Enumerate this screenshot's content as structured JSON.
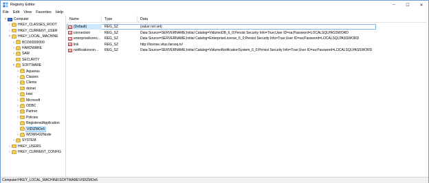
{
  "window": {
    "title": "Registry Editor",
    "controls": [
      "–",
      "☐",
      "✕"
    ]
  },
  "menu": [
    "File",
    "Edit",
    "View",
    "Favorites",
    "Help"
  ],
  "tree": [
    {
      "label": "Computer",
      "level": 0,
      "expander": "open",
      "icon": "computer-icon"
    },
    {
      "label": "HKEY_CLASSES_ROOT",
      "level": 1,
      "expander": "closed",
      "icon": "folder-icon"
    },
    {
      "label": "HKEY_CURRENT_USER",
      "level": 1,
      "expander": "closed",
      "icon": "folder-icon"
    },
    {
      "label": "HKEY_LOCAL_MACHINE",
      "level": 1,
      "expander": "open",
      "icon": "folder-icon"
    },
    {
      "label": "BCD00000000",
      "level": 2,
      "expander": "closed",
      "icon": "folder-icon"
    },
    {
      "label": "HARDWARE",
      "level": 2,
      "expander": "closed",
      "icon": "folder-icon"
    },
    {
      "label": "SAM",
      "level": 2,
      "expander": "closed",
      "icon": "folder-icon"
    },
    {
      "label": "SECURITY",
      "level": 2,
      "expander": "none",
      "icon": "folder-icon"
    },
    {
      "label": "SOFTWARE",
      "level": 2,
      "expander": "open",
      "icon": "folder-icon"
    },
    {
      "label": "Aquarius",
      "level": 3,
      "expander": "closed",
      "icon": "folder-icon"
    },
    {
      "label": "Classes",
      "level": 3,
      "expander": "closed",
      "icon": "folder-icon"
    },
    {
      "label": "Clients",
      "level": 3,
      "expander": "closed",
      "icon": "folder-icon"
    },
    {
      "label": "dotnet",
      "level": 3,
      "expander": "closed",
      "icon": "folder-icon"
    },
    {
      "label": "Intel",
      "level": 3,
      "expander": "closed",
      "icon": "folder-icon"
    },
    {
      "label": "Microsoft",
      "level": 3,
      "expander": "closed",
      "icon": "folder-icon"
    },
    {
      "label": "ODBC",
      "level": 3,
      "expander": "closed",
      "icon": "folder-icon"
    },
    {
      "label": "Partner",
      "level": 3,
      "expander": "closed",
      "icon": "folder-icon"
    },
    {
      "label": "Policies",
      "level": 3,
      "expander": "closed",
      "icon": "folder-icon"
    },
    {
      "label": "RegisteredApplication",
      "level": 3,
      "expander": "none",
      "icon": "folder-icon"
    },
    {
      "label": "VIDIZMOv6",
      "level": 3,
      "expander": "none",
      "icon": "folder-icon",
      "selected": true
    },
    {
      "label": "WOW6432Node",
      "level": 3,
      "expander": "closed",
      "icon": "folder-icon"
    },
    {
      "label": "SYSTEM",
      "level": 2,
      "expander": "closed",
      "icon": "folder-icon"
    },
    {
      "label": "HKEY_USERS",
      "level": 1,
      "expander": "closed",
      "icon": "folder-icon"
    },
    {
      "label": "HKEY_CURRENT_CONFIG",
      "level": 1,
      "expander": "closed",
      "icon": "folder-icon"
    }
  ],
  "list": {
    "columns": [
      "Name",
      "Type",
      "Data"
    ],
    "rows": [
      {
        "name": "(Default)",
        "type": "REG_SZ",
        "data": "(value not set)",
        "selected": true
      },
      {
        "name": "connection",
        "type": "REG_SZ",
        "data": "Data Source=SERVERNAME;Initial Catalog=VidizmoDB_6_0;Persist Security Info=True;User ID=sa;Password=LOCALSQLPASSWORD"
      },
      {
        "name": "enterpriselicenc...",
        "type": "REG_SZ",
        "data": "Data Source=SERVERNAME;Initial Catalog=EnterpriseLicense_6_0;Persist Security Info=True;User ID=sa;Password=LOCALSQLPASSWORD"
      },
      {
        "name": "link",
        "type": "REG_SZ",
        "data": "http://license.vitus.farooq.tv/"
      },
      {
        "name": "notificationcon...",
        "type": "REG_SZ",
        "data": "Data Source=SERVERNAME;Initial Catalog=VidizmoNotificationSystem_6_0;Persist Security Info=True;User ID=sa;Password=LOCALSQLPASSWORD"
      }
    ],
    "value_icon_text": "ab"
  },
  "status": {
    "path": "Computer\\HKEY_LOCAL_MACHINE\\SOFTWARE\\VIDIZMOv6"
  }
}
